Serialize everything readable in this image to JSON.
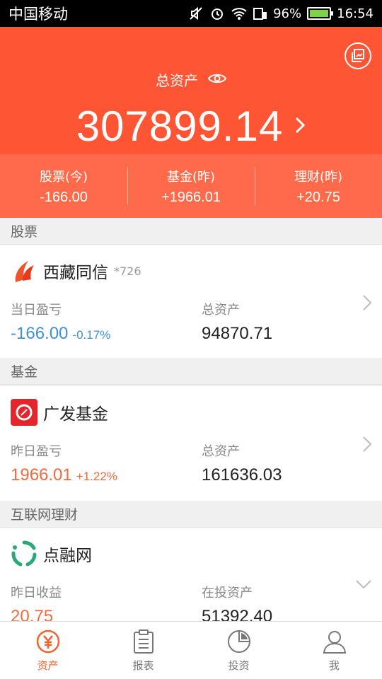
{
  "status_bar": {
    "carrier": "中国移动",
    "battery": "96%",
    "time": "16:54"
  },
  "header": {
    "title": "总资产",
    "total_value": "307899.14"
  },
  "summary": [
    {
      "label": "股票(今)",
      "value": "-166.00"
    },
    {
      "label": "基金(昨)",
      "value": "+1966.01"
    },
    {
      "label": "理财(昨)",
      "value": "+20.75"
    }
  ],
  "sections": {
    "stocks": {
      "header": "股票",
      "brand": "西藏同信",
      "account": "*726",
      "left_label": "当日盈亏",
      "left_value": "-166.00",
      "left_pct": "-0.17%",
      "right_label": "总资产",
      "right_value": "94870.71"
    },
    "funds": {
      "header": "基金",
      "brand": "广发基金",
      "left_label": "昨日盈亏",
      "left_value": "1966.01",
      "left_pct": "+1.22%",
      "right_label": "总资产",
      "right_value": "161636.03"
    },
    "p2p": {
      "header": "互联网理财",
      "brand": "点融网",
      "left_label": "昨日收益",
      "left_value": "20.75",
      "right_label": "在投资产",
      "right_value": "51392.40"
    }
  },
  "tabbar": [
    {
      "label": "资产",
      "icon": "yuan-circle-icon",
      "active": true
    },
    {
      "label": "报表",
      "icon": "clipboard-icon",
      "active": false
    },
    {
      "label": "投资",
      "icon": "pie-chart-icon",
      "active": false
    },
    {
      "label": "我",
      "icon": "person-icon",
      "active": false
    }
  ],
  "colors": {
    "brand_orange": "#fe5534",
    "summary_orange": "#ff6a4a",
    "negative_blue": "#3d8fe0",
    "positive_orange": "#f26a3d"
  }
}
